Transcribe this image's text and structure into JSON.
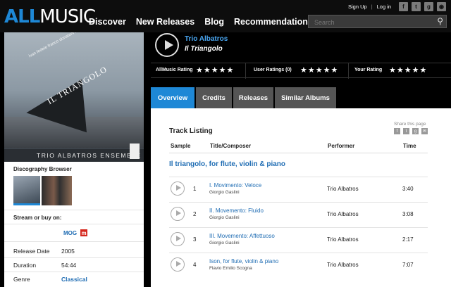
{
  "header": {
    "logo_all": "ALL",
    "logo_music": "MUSIC",
    "nav": [
      "Discover",
      "New Releases",
      "Blog",
      "Recommendations"
    ],
    "sign_up": "Sign Up",
    "separator": "|",
    "log_in": "Log in",
    "social_icons": [
      "facebook-icon",
      "twitter-icon",
      "googleplus-icon",
      "rss-icon"
    ],
    "search_placeholder": "Search"
  },
  "cover": {
    "title": "IL TRIANGOLO",
    "band": "TRIO ALBATROS ENSEMBLE",
    "names": "ivan fedele  franco donatoni  luciano"
  },
  "sidebar": {
    "discography_browser": "Discography Browser",
    "stream_label": "Stream or buy on:",
    "stream_service": "MOG",
    "stream_service_badge": "m",
    "meta": [
      {
        "key": "Release Date",
        "value": "2005",
        "link": false
      },
      {
        "key": "Duration",
        "value": "54:44",
        "link": false
      },
      {
        "key": "Genre",
        "value": "Classical",
        "link": true
      }
    ]
  },
  "album": {
    "artist": "Trio Albatros",
    "title": "Il Triangolo"
  },
  "ratings": {
    "allmusic_label": "AllMusic Rating",
    "user_label": "User Ratings (0)",
    "your_label": "Your Rating",
    "stars": "★★★★★"
  },
  "tabs": [
    "Overview",
    "Credits",
    "Releases",
    "Similar Albums"
  ],
  "active_tab": "Overview",
  "track_listing": {
    "title": "Track Listing",
    "share_label": "Share this page",
    "columns": [
      "Sample",
      "Title/Composer",
      "Performer",
      "Time"
    ],
    "work_title": "Il triangolo, for flute, violin & piano",
    "tracks": [
      {
        "num": "1",
        "title": "I. Movimento: Veloce",
        "composer": "Giorgio Gaslini",
        "performer": "Trio Albatros",
        "time": "3:40"
      },
      {
        "num": "2",
        "title": "II. Movemento: Fluido",
        "composer": "Giorgio Gaslini",
        "performer": "Trio Albatros",
        "time": "3:08"
      },
      {
        "num": "3",
        "title": "III. Movemento: Affettuoso",
        "composer": "Giorgio Gaslini",
        "performer": "Trio Albatros",
        "time": "2:17"
      },
      {
        "num": "4",
        "title": "Ison, for flute, violin & piano",
        "composer": "Flavio Emilio Scogna",
        "performer": "Trio Albatros",
        "time": "7:07"
      }
    ]
  },
  "colors": {
    "accent_blue": "#1e88d6",
    "link_blue": "#1e6cb3",
    "artist_blue": "#49a6f1",
    "background": "#000000"
  }
}
